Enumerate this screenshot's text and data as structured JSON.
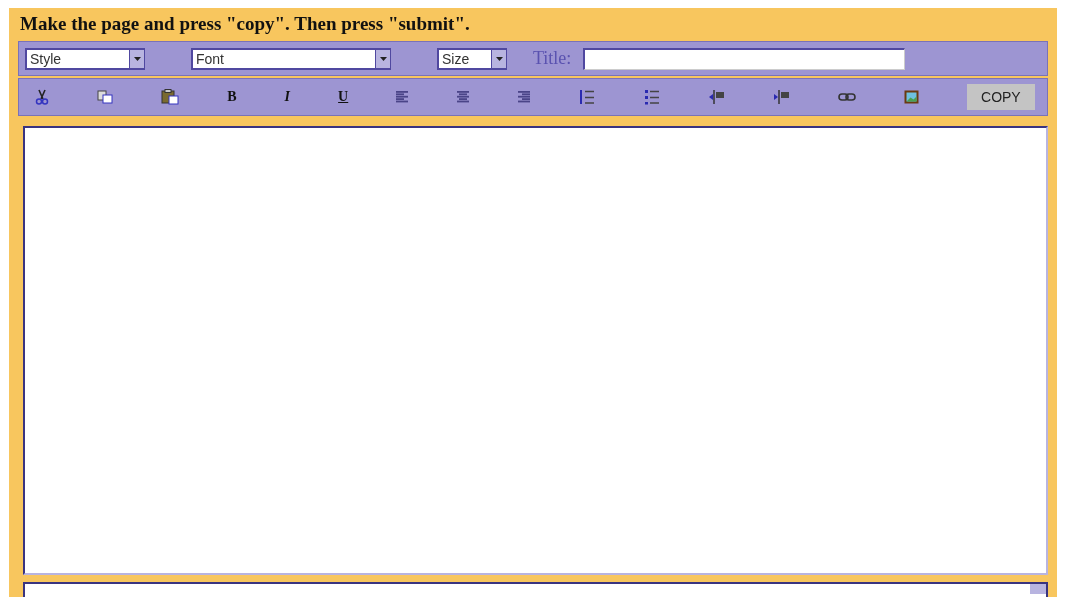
{
  "instruction": "Make the page and press \"copy\". Then press \"submit\".",
  "selects": [
    {
      "kind": "style",
      "value": "Style"
    },
    {
      "kind": "font",
      "value": "Font"
    },
    {
      "kind": "size",
      "value": "Size"
    }
  ],
  "title_label": "Title:",
  "toolbar": [
    {
      "kind": "cut"
    },
    {
      "kind": "copy"
    },
    {
      "kind": "paste"
    },
    {
      "kind": "bold",
      "label": "B"
    },
    {
      "kind": "italic",
      "label": "I"
    },
    {
      "kind": "underline",
      "label": "U"
    },
    {
      "kind": "align-left"
    },
    {
      "kind": "align-center"
    },
    {
      "kind": "align-right"
    },
    {
      "kind": "ordered-list"
    },
    {
      "kind": "bullet-list"
    },
    {
      "kind": "outdent"
    },
    {
      "kind": "indent"
    },
    {
      "kind": "link"
    },
    {
      "kind": "image"
    }
  ],
  "copy_button": "COPY"
}
